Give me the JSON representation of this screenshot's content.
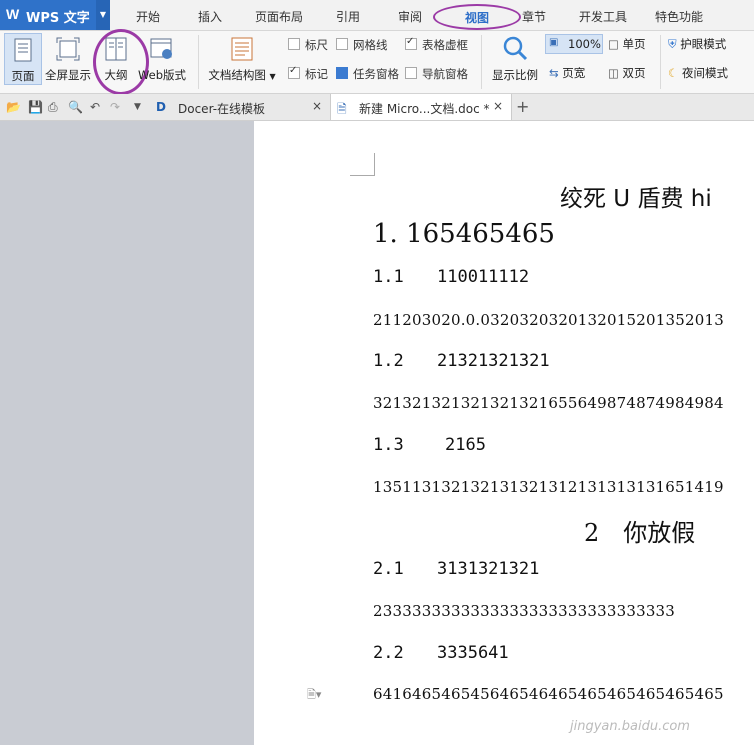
{
  "app": {
    "name": "WPS 文字",
    "logo": "W"
  },
  "menu": {
    "tabs": [
      "开始",
      "插入",
      "页面布局",
      "引用",
      "审阅",
      "视图",
      "章节",
      "开发工具",
      "特色功能"
    ],
    "active": "视图"
  },
  "ribbon": {
    "page_view": "页面",
    "fullscreen": "全屏显示",
    "outline": "大纲",
    "web_layout": "Web版式",
    "doc_structure": "文档结构图",
    "ruler": "标尺",
    "gridlines": "网格线",
    "table_gridlines": "表格虚框",
    "marks": "标记",
    "task_pane": "任务窗格",
    "nav_pane": "导航窗格",
    "zoom_ratio": "显示比例",
    "zoom_value": "100%",
    "page_width": "页宽",
    "single_page": "单页",
    "two_pages": "双页",
    "eye_mode": "护眼模式",
    "night_mode": "夜间模式"
  },
  "tabs_bar": {
    "docer_tab": "Docer-在线模板",
    "doc_tab": "新建 Micro...文档.doc *",
    "close_glyph": "×",
    "add_glyph": "+"
  },
  "document": {
    "title": "绞死 U 盾费 hi",
    "heading1": "1. 165465465",
    "s11_num": "1.1",
    "s11_text": "110011112",
    "p1": "211203020.0.0320320320132015201352013",
    "s12_num": "1.2",
    "s12_text": "21321321321",
    "p2": "321321321321321321655649874874984984",
    "s13_num": "1.3",
    "s13_text": "2165",
    "p3": "135113132132131321312131313131651419",
    "chapter2": "2　你放假",
    "s21_num": "2.1",
    "s21_text": "3131321321",
    "p4": "2333333333333333333333333333333",
    "s22_num": "2.2",
    "s22_text": "3335641",
    "p5": "641646546545646546465465465465465465"
  },
  "watermark": "jingyan.baidu.com"
}
